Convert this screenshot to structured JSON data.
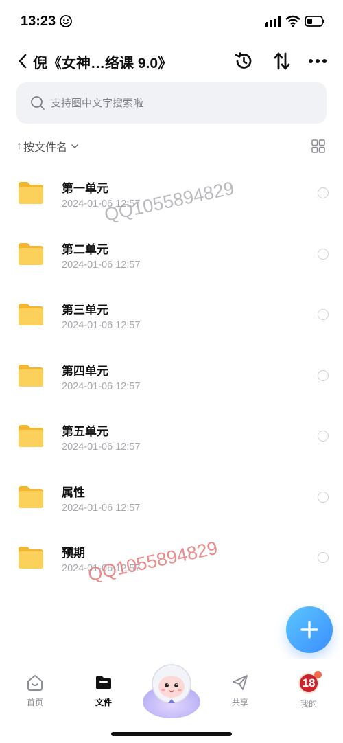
{
  "status_bar": {
    "time": "13:23"
  },
  "header": {
    "title": "倪《女神…络课 9.0》"
  },
  "search": {
    "placeholder": "支持图中文字搜索啦"
  },
  "sort": {
    "arrow": "↑",
    "label": "按文件名"
  },
  "files": [
    {
      "name": "第一单元",
      "date": "2024-01-06 12:57"
    },
    {
      "name": "第二单元",
      "date": "2024-01-06 12:57"
    },
    {
      "name": "第三单元",
      "date": "2024-01-06 12:57"
    },
    {
      "name": "第四单元",
      "date": "2024-01-06 12:57"
    },
    {
      "name": "第五单元",
      "date": "2024-01-06 12:57"
    },
    {
      "name": "属性",
      "date": "2024-01-06 12:57"
    },
    {
      "name": "预期",
      "date": "2024-01-06 12:57"
    }
  ],
  "watermark": "QQ1055894829",
  "nav": {
    "home": "首页",
    "files": "文件",
    "share": "共享",
    "mine": "我的",
    "avatar_text": "18"
  },
  "colors": {
    "folder": "#f9c84a",
    "fab_start": "#5cc7ff",
    "fab_end": "#3a8dff",
    "search_bg": "#f1f2f6"
  }
}
